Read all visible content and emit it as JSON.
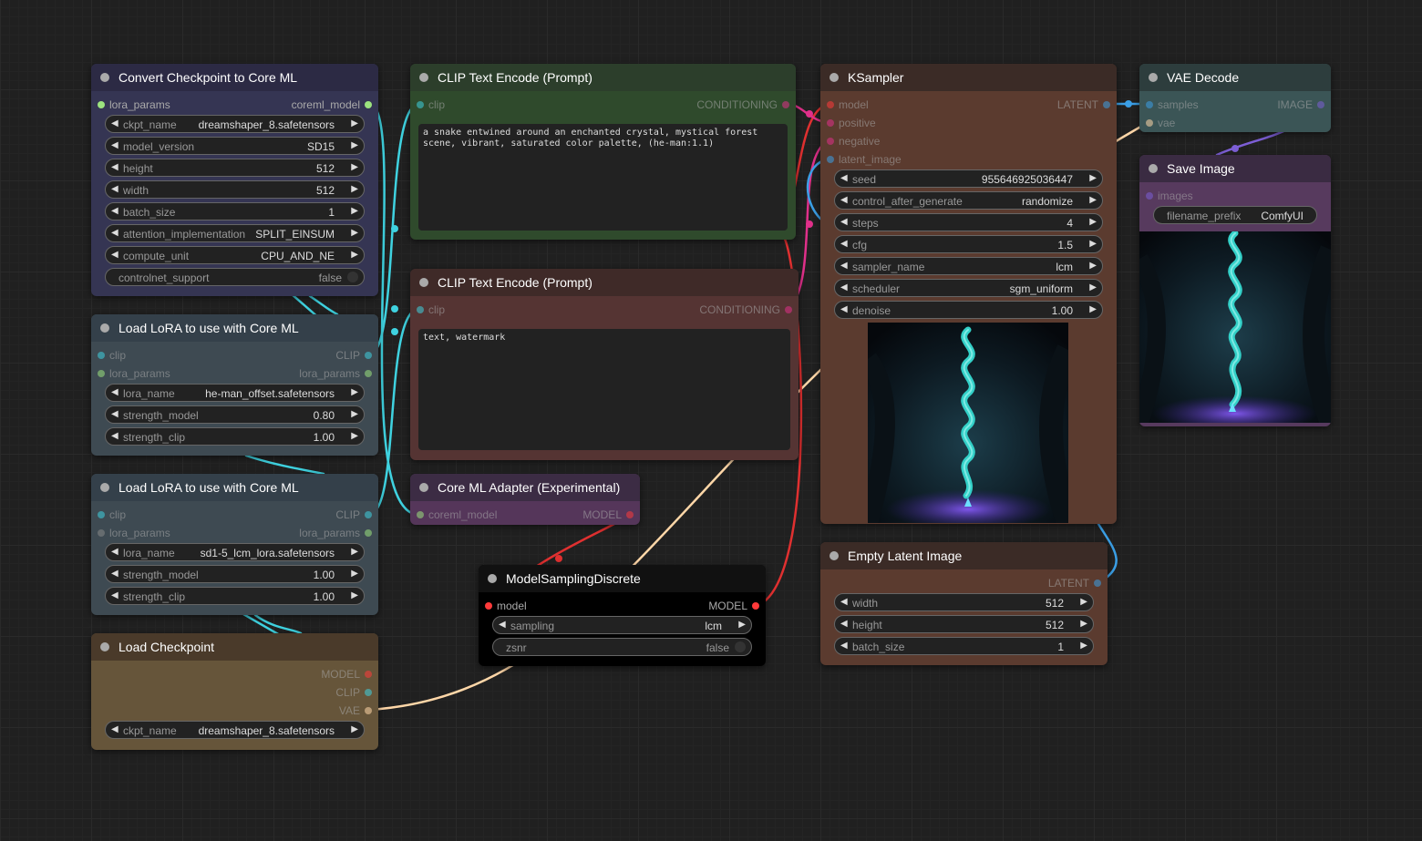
{
  "colors": {
    "clip": "#3fd2e0",
    "model": "#ff3a3a",
    "conditioning": "#e0308a",
    "latent": "#3b9fe6",
    "vae": "#ffd7a8",
    "image": "#7d5fd6",
    "lora_params": "#9ce37f"
  },
  "nodes": {
    "convert": {
      "title": "Convert Checkpoint to Core ML",
      "in_lora_params": "lora_params",
      "out_coreml_model": "coreml_model",
      "w_ckpt_name_label": "ckpt_name",
      "w_ckpt_name_value": "dreamshaper_8.safetensors",
      "w_model_version_label": "model_version",
      "w_model_version_value": "SD15",
      "w_height_label": "height",
      "w_height_value": "512",
      "w_width_label": "width",
      "w_width_value": "512",
      "w_batch_size_label": "batch_size",
      "w_batch_size_value": "1",
      "w_attention_label": "attention_implementation",
      "w_attention_value": "SPLIT_EINSUM",
      "w_compute_unit_label": "compute_unit",
      "w_compute_unit_value": "CPU_AND_NE",
      "w_controlnet_label": "controlnet_support",
      "w_controlnet_value": "false"
    },
    "lora1": {
      "title": "Load LoRA to use with Core ML",
      "in_clip": "clip",
      "in_lora_params": "lora_params",
      "out_clip": "CLIP",
      "out_lora_params": "lora_params",
      "w_lora_name_label": "lora_name",
      "w_lora_name_value": "he-man_offset.safetensors",
      "w_strength_model_label": "strength_model",
      "w_strength_model_value": "0.80",
      "w_strength_clip_label": "strength_clip",
      "w_strength_clip_value": "1.00"
    },
    "lora2": {
      "title": "Load LoRA to use with Core ML",
      "in_clip": "clip",
      "in_lora_params": "lora_params",
      "out_clip": "CLIP",
      "out_lora_params": "lora_params",
      "w_lora_name_label": "lora_name",
      "w_lora_name_value": "sd1-5_lcm_lora.safetensors",
      "w_strength_model_label": "strength_model",
      "w_strength_model_value": "1.00",
      "w_strength_clip_label": "strength_clip",
      "w_strength_clip_value": "1.00"
    },
    "checkpoint": {
      "title": "Load Checkpoint",
      "out_model": "MODEL",
      "out_clip": "CLIP",
      "out_vae": "VAE",
      "w_ckpt_name_label": "ckpt_name",
      "w_ckpt_name_value": "dreamshaper_8.safetensors"
    },
    "clip_pos": {
      "title": "CLIP Text Encode (Prompt)",
      "in_clip": "clip",
      "out_conditioning": "CONDITIONING",
      "text": "a snake entwined around an enchanted crystal, mystical forest scene, vibrant, saturated color palette, (he-man:1.1)"
    },
    "clip_neg": {
      "title": "CLIP Text Encode (Prompt)",
      "in_clip": "clip",
      "out_conditioning": "CONDITIONING",
      "text": "text, watermark"
    },
    "adapter": {
      "title": "Core ML Adapter (Experimental)",
      "in_coreml_model": "coreml_model",
      "out_model": "MODEL"
    },
    "msd": {
      "title": "ModelSamplingDiscrete",
      "in_model": "model",
      "out_model": "MODEL",
      "w_sampling_label": "sampling",
      "w_sampling_value": "lcm",
      "w_zsnr_label": "zsnr",
      "w_zsnr_value": "false"
    },
    "ksampler": {
      "title": "KSampler",
      "in_model": "model",
      "in_positive": "positive",
      "in_negative": "negative",
      "in_latent_image": "latent_image",
      "out_latent": "LATENT",
      "w_seed_label": "seed",
      "w_seed_value": "955646925036447",
      "w_control_label": "control_after_generate",
      "w_control_value": "randomize",
      "w_steps_label": "steps",
      "w_steps_value": "4",
      "w_cfg_label": "cfg",
      "w_cfg_value": "1.5",
      "w_sampler_label": "sampler_name",
      "w_sampler_value": "lcm",
      "w_scheduler_label": "scheduler",
      "w_scheduler_value": "sgm_uniform",
      "w_denoise_label": "denoise",
      "w_denoise_value": "1.00"
    },
    "empty_latent": {
      "title": "Empty Latent Image",
      "out_latent": "LATENT",
      "w_width_label": "width",
      "w_width_value": "512",
      "w_height_label": "height",
      "w_height_value": "512",
      "w_batch_label": "batch_size",
      "w_batch_value": "1"
    },
    "vae_decode": {
      "title": "VAE Decode",
      "in_samples": "samples",
      "in_vae": "vae",
      "out_image": "IMAGE"
    },
    "save_image": {
      "title": "Save Image",
      "in_images": "images",
      "w_prefix_label": "filename_prefix",
      "w_prefix_value": "ComfyUI"
    }
  }
}
